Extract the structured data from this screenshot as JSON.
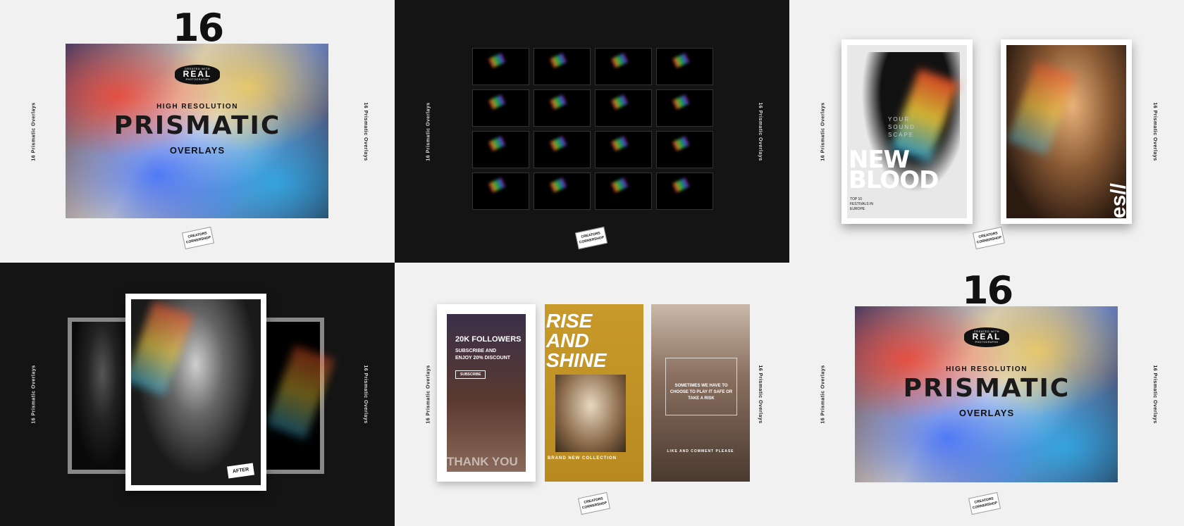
{
  "side_label": "16 Prismatic Overlays",
  "cover": {
    "number": "16",
    "badge_top": "CREATED WITH",
    "badge_word": "REAL",
    "badge_bottom": "PHOTOGRAPHS",
    "subtitle": "HIGH RESOLUTION",
    "title": "PRISMATIC",
    "tagline": "OVERLAYS"
  },
  "logo_text": "CREATORS CORNERSHOP",
  "magazine": {
    "overlay_small": "YOUR SOUND SCAPE",
    "headline_1": "NEW",
    "headline_2": "BLOOD",
    "footer": "TOP 10 FESTIVALS IN EUROPE",
    "vibes": "vibes//"
  },
  "before_after": {
    "tag": "AFTER"
  },
  "stories": {
    "s1_title": "20K FOLLOWERS",
    "s1_sub": "SUBSCRIBE AND ENJOY 20% DISCOUNT",
    "s1_btn": "SUBSCRIBE",
    "s1_thanks": "THANK YOU",
    "s2_title_1": "RISE",
    "s2_title_2": "AND",
    "s2_title_3": "SHINE",
    "s2_footer": "BRAND NEW COLLECTION",
    "s3_quote": "SOMETIMES WE HAVE TO CHOOSE TO PLAY IT SAFE OR TAKE A RISK",
    "s3_footer": "LIKE AND COMMENT PLEASE"
  }
}
